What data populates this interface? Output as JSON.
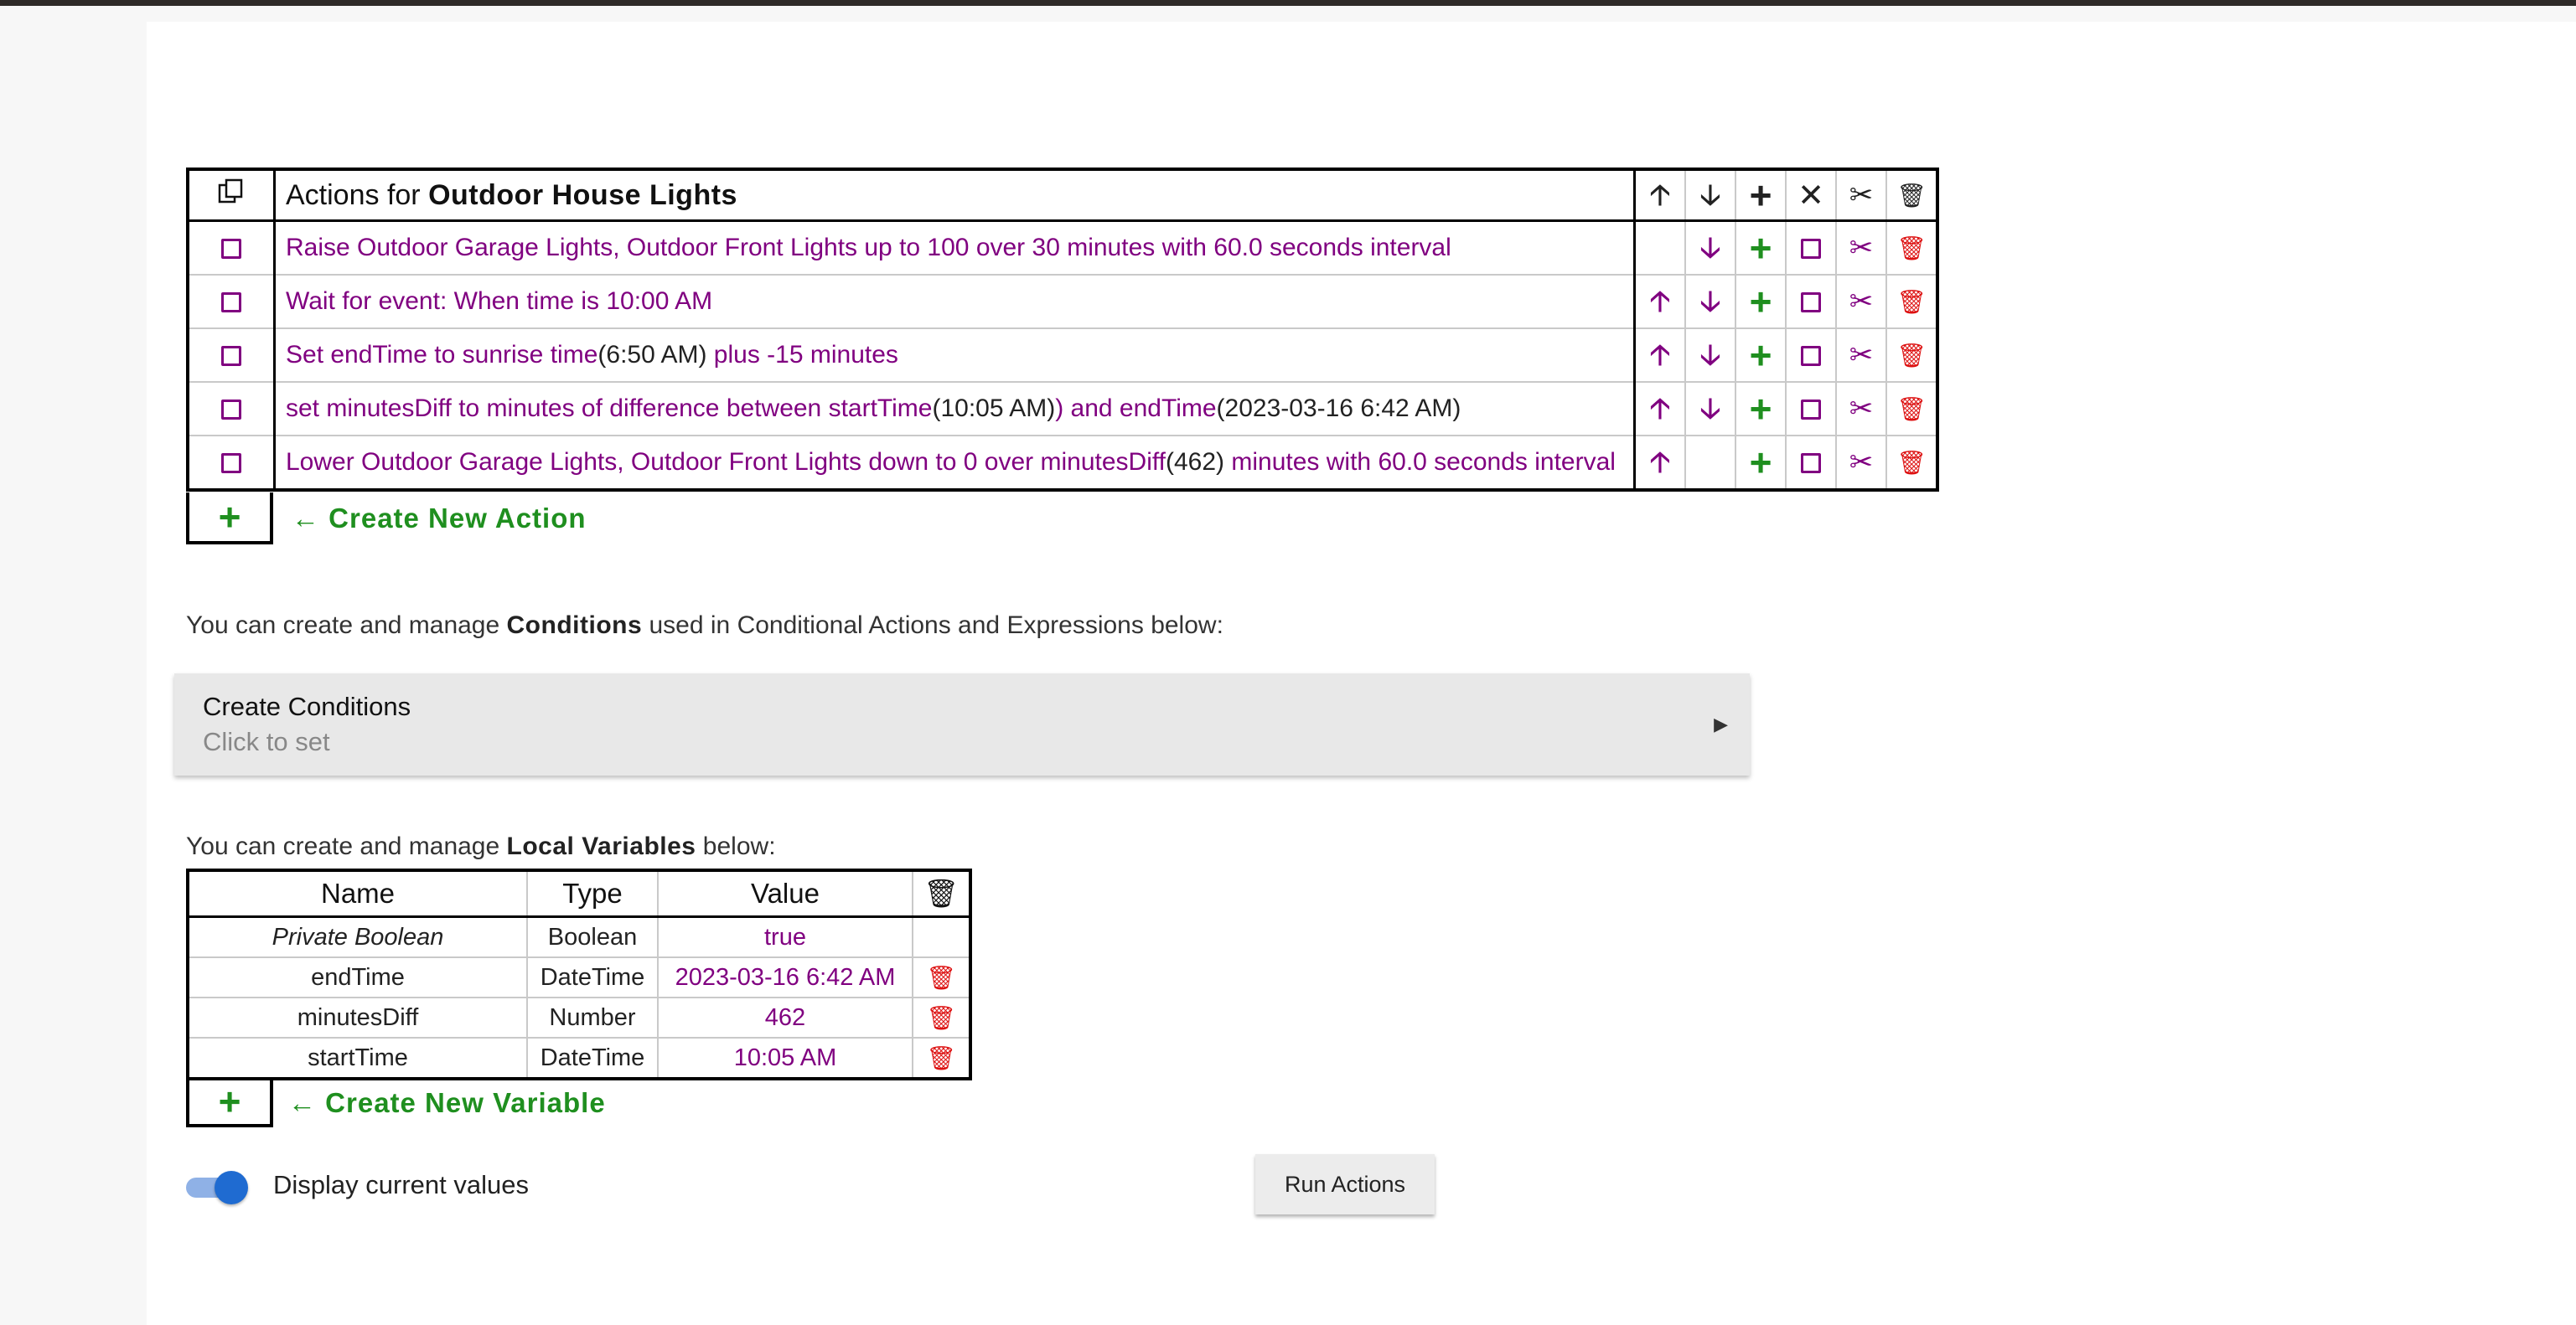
{
  "actions": {
    "header": {
      "prefix": "Actions for ",
      "device": "Outdoor House Lights",
      "copy_icon": "copy-icon",
      "up": "🡡",
      "down": "🡣",
      "plus": "+",
      "x": "✕",
      "scissors": "✂",
      "trash": "🗑"
    },
    "rows": [
      {
        "segments": [
          {
            "t": "Raise Outdoor Garage Lights, Outdoor Front Lights up to 100 over 30 minutes with 60.0 seconds interval",
            "c": "purple"
          }
        ],
        "up": false,
        "down": true
      },
      {
        "segments": [
          {
            "t": "Wait for event: When time is 10:00 AM",
            "c": "purple"
          }
        ],
        "up": true,
        "down": true
      },
      {
        "segments": [
          {
            "t": "Set endTime to sunrise time",
            "c": "purple"
          },
          {
            "t": "(6:50 AM)",
            "c": "black"
          },
          {
            "t": " plus -15 minutes",
            "c": "purple"
          }
        ],
        "up": true,
        "down": true
      },
      {
        "segments": [
          {
            "t": "set minutesDiff to minutes of difference between startTime",
            "c": "purple"
          },
          {
            "t": "(10:05 AM)",
            "c": "black"
          },
          {
            "t": ") and endTime",
            "c": "purple"
          },
          {
            "t": "(2023-03-16 6:42 AM)",
            "c": "black"
          }
        ],
        "up": true,
        "down": true
      },
      {
        "segments": [
          {
            "t": "Lower Outdoor Garage Lights, Outdoor Front Lights down to 0 over minutesDiff",
            "c": "purple"
          },
          {
            "t": "(462)",
            "c": "black"
          },
          {
            "t": " minutes with 60.0 seconds interval",
            "c": "purple"
          }
        ],
        "up": true,
        "down": false
      }
    ],
    "create_new": "← Create New Action"
  },
  "conditions": {
    "intro_prefix": "You can create and manage ",
    "intro_bold": "Conditions",
    "intro_suffix": " used in Conditional Actions and Expressions below:",
    "title": "Create Conditions",
    "subtitle": "Click to set"
  },
  "variables": {
    "intro_prefix": "You can create and manage ",
    "intro_bold": "Local Variables",
    "intro_suffix": " below:",
    "columns": [
      "Name",
      "Type",
      "Value"
    ],
    "rows": [
      {
        "name": "Private Boolean",
        "type": "Boolean",
        "value": "true",
        "italic": true,
        "deletable": false
      },
      {
        "name": "endTime",
        "type": "DateTime",
        "value": "2023-03-16 6:42 AM",
        "italic": false,
        "deletable": true
      },
      {
        "name": "minutesDiff",
        "type": "Number",
        "value": "462",
        "italic": false,
        "deletable": true
      },
      {
        "name": "startTime",
        "type": "DateTime",
        "value": "10:05 AM",
        "italic": false,
        "deletable": true
      }
    ],
    "create_new": "← Create New Variable"
  },
  "footer": {
    "toggle_label": "Display current values",
    "toggle_on": true,
    "run_button": "Run Actions"
  },
  "colors": {
    "accent": "#800080",
    "add": "#1f8f1f",
    "delete": "#dd1111",
    "toggle": "#1f6bd1"
  }
}
